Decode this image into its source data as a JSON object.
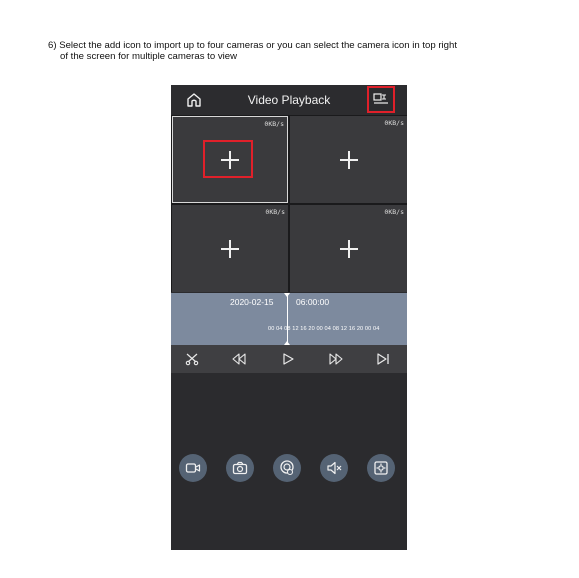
{
  "instruction": {
    "line1": "6) Select the add icon to import up to four cameras or you can select the camera icon in top right",
    "line2": "of the screen for multiple cameras to view"
  },
  "app": {
    "title": "Video Playback",
    "icons": {
      "home": "home-icon",
      "multi_camera": "multi-camera-icon"
    }
  },
  "cameras": [
    {
      "rate": "0KB/s"
    },
    {
      "rate": "0KB/s"
    },
    {
      "rate": "0KB/s"
    },
    {
      "rate": "0KB/s"
    }
  ],
  "timeline": {
    "date": "2020-02-15",
    "time": "06:00:00",
    "ticks": "00 04 08 12 16 20 00 04 08 12 16 20 00 04"
  },
  "controls": [
    "cut-icon",
    "rewind-icon",
    "play-icon",
    "fast-forward-icon",
    "next-frame-icon"
  ],
  "actions": [
    "record-icon",
    "snapshot-icon",
    "intercom-icon",
    "mute-icon",
    "ptz-icon"
  ],
  "colors": {
    "highlight": "#e0202a",
    "timeline": "#7d8a9e",
    "action_button": "#556374"
  }
}
